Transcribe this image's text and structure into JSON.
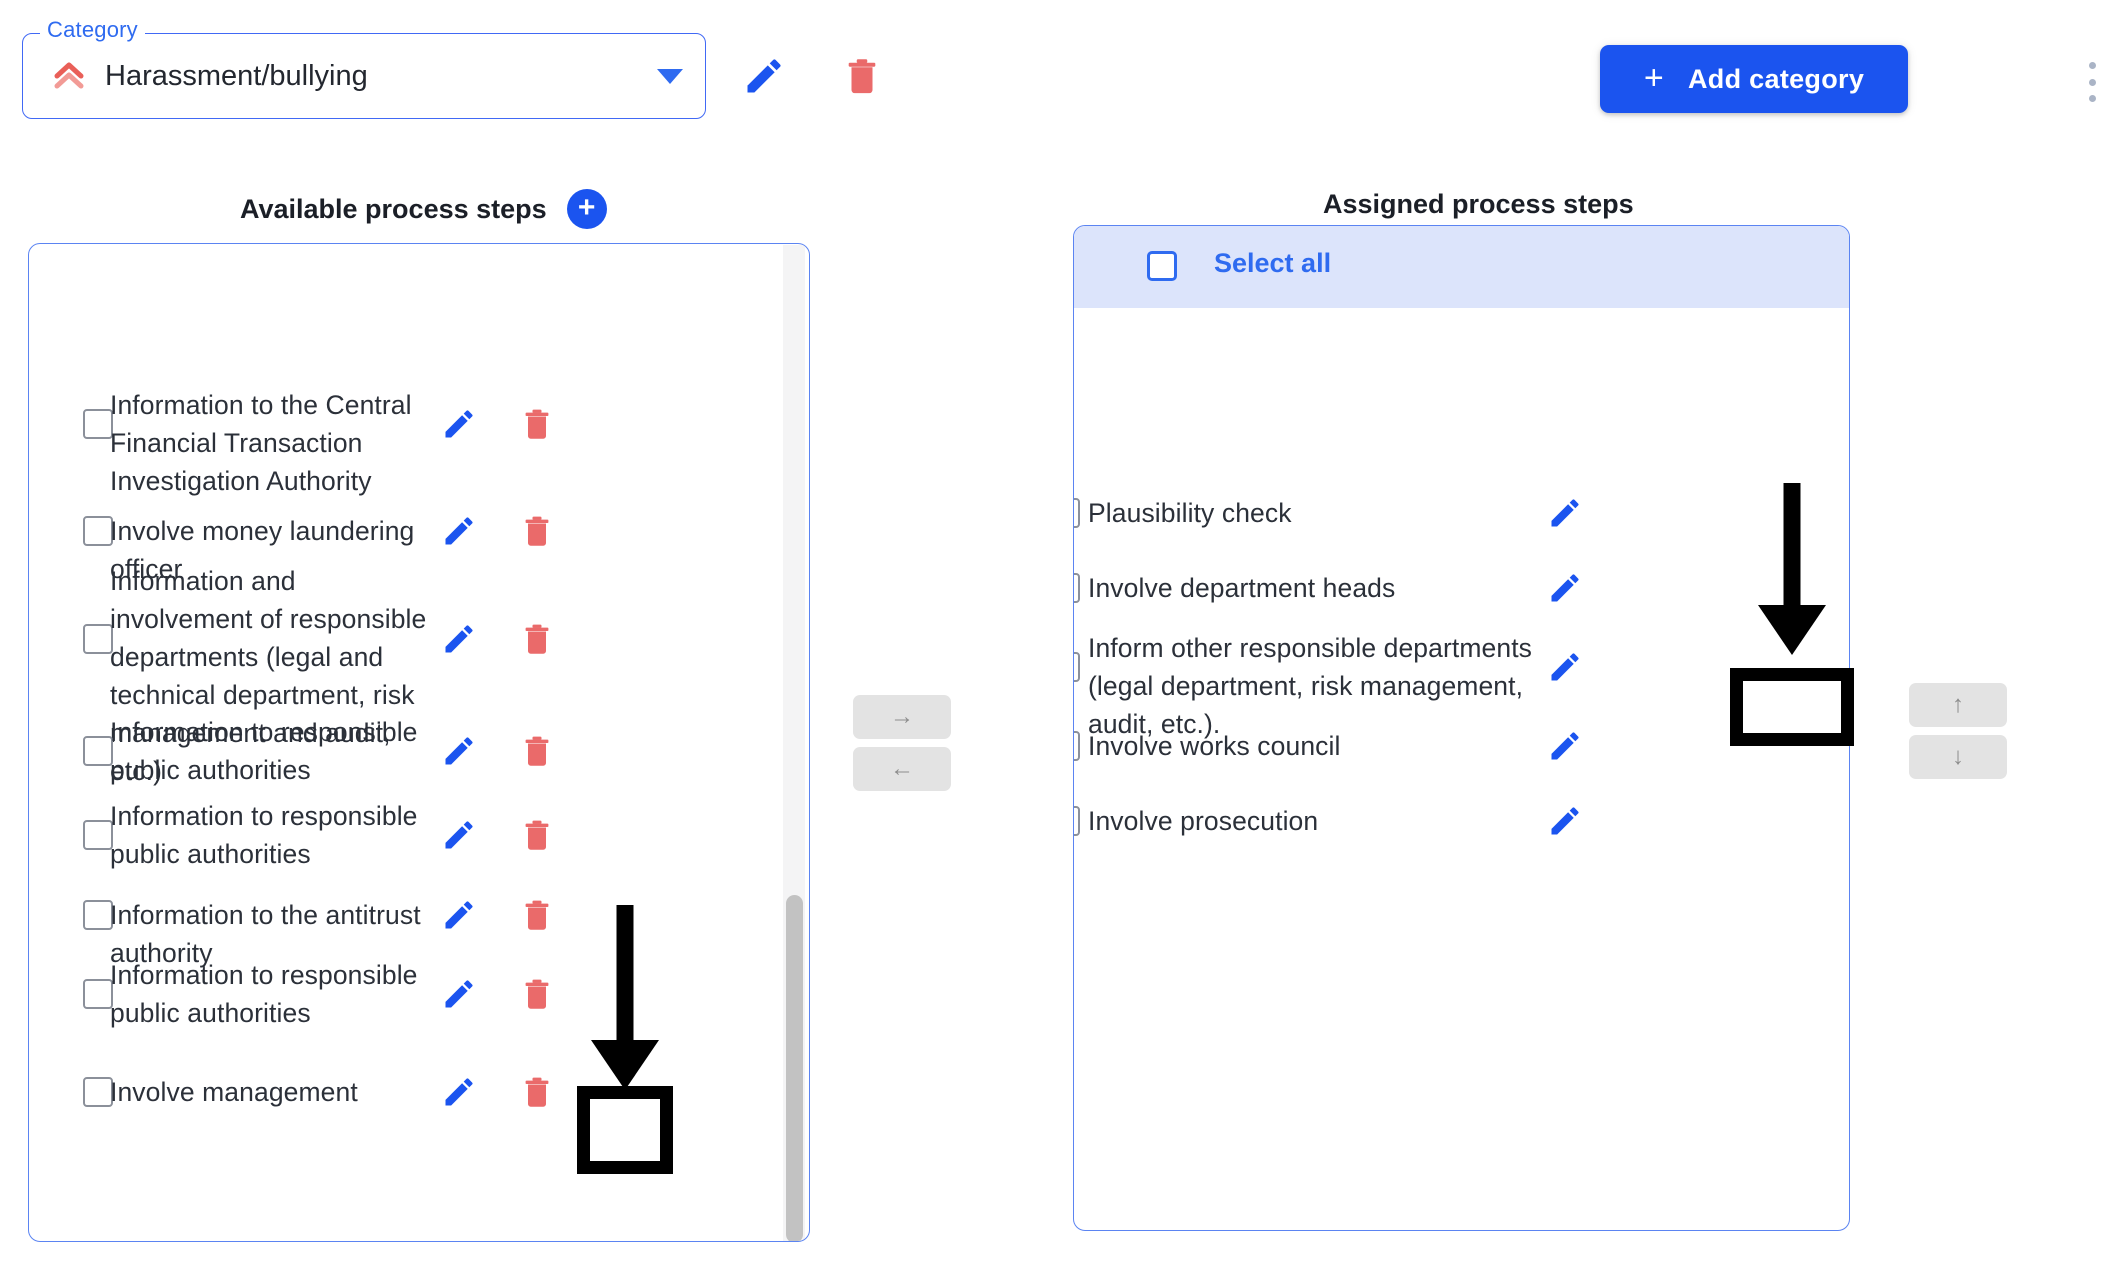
{
  "header": {
    "category_legend": "Category",
    "category_value": "Harassment/bullying",
    "category_icon": "double-chevron-up-icon",
    "dropdown_icon": "chevron-down-icon",
    "edit_icon": "pencil-icon",
    "delete_icon": "trash-icon",
    "add_category_label": "Add category",
    "add_category_plus": "+",
    "overflow_icon": "kebab-menu-icon",
    "accent_blue": "#1b54ef",
    "accent_red": "#ea6a6a"
  },
  "left_panel": {
    "title": "Available process steps",
    "add_icon_label": "+",
    "items": [
      {
        "label": "Information to the Central Financial Transaction Investigation Authority",
        "checked": false
      },
      {
        "label": "Involve money laundering officer",
        "checked": false
      },
      {
        "label": "Information and involvement of responsible departments (legal and technical department, risk management and audit, etc.)",
        "checked": false
      },
      {
        "label": "Information to responsible public authorities",
        "checked": false
      },
      {
        "label": "Information to responsible public authorities",
        "checked": false
      },
      {
        "label": "Information to the antitrust authority",
        "checked": false
      },
      {
        "label": "Information to responsible public authorities",
        "checked": false
      },
      {
        "label": "Involve management",
        "checked": false
      }
    ]
  },
  "right_panel": {
    "title": "Assigned process steps",
    "select_all_label": "Select all",
    "select_all_checked": false,
    "items": [
      {
        "label": "Plausibility check",
        "checked": false
      },
      {
        "label": "Involve department heads",
        "checked": false
      },
      {
        "label": "Inform other responsible departments (legal department, risk management, audit, etc.).",
        "checked": false
      },
      {
        "label": "Involve works council",
        "checked": false
      },
      {
        "label": "Involve prosecution",
        "checked": false
      }
    ]
  },
  "transfer_controls": {
    "move_right": "→",
    "move_left": "←",
    "move_up": "↑",
    "move_down": "↓"
  },
  "annotations": {
    "left_highlight_target": "edit-process-step-involve-management",
    "right_highlight_target": "edit-process-step-involve-works-council",
    "arrow_color": "#000000"
  }
}
